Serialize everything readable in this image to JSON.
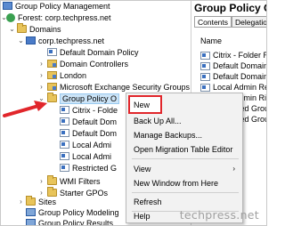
{
  "tree": {
    "root_label": "Group Policy Management",
    "forest_label": "Forest: corp.techpress.net",
    "domains_label": "Domains",
    "domain_label": "corp.techpress.net",
    "items": [
      "Default Domain Policy",
      "Domain Controllers",
      "London",
      "Microsoft Exchange Security Groups",
      "Group Policy O",
      "Citrix - Folde",
      "Default Dom",
      "Default Dom",
      "Local Admi",
      "Local Admi",
      "Restricted G",
      "WMI Filters",
      "Starter GPOs"
    ],
    "sites_label": "Sites",
    "modeling_label": "Group Policy Modeling",
    "results_label": "Group Policy Results"
  },
  "right": {
    "title": "Group Policy Obj",
    "tabs": [
      "Contents",
      "Delegation"
    ],
    "column_header": "Name",
    "items": [
      "Citrix - Folder Redi",
      "Default Domain Co",
      "Default Domain Po",
      "Local Admin Remo",
      "Local Admin Rights",
      "Restricted Group",
      "Restricted Group"
    ]
  },
  "context_menu": {
    "items": {
      "new": "New",
      "backup_all": "Back Up All...",
      "manage_backups": "Manage Backups...",
      "open_migration": "Open Migration Table Editor",
      "view": "View",
      "new_window": "New Window from Here",
      "refresh": "Refresh",
      "help": "Help"
    }
  },
  "watermark": "techpress.net",
  "colors": {
    "highlight": "#e1262b",
    "selection": "#cce4f7",
    "folder": "#e8c45a"
  }
}
